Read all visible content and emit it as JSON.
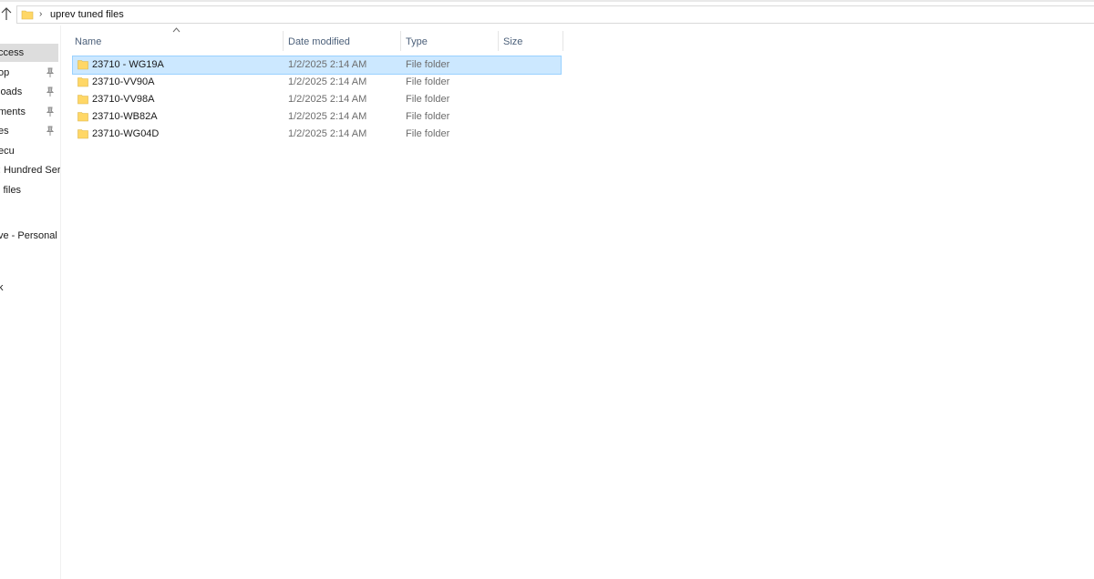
{
  "address": {
    "path_label": "uprev tuned files"
  },
  "nav": {
    "items": [
      {
        "label": "ccess",
        "pinned": false,
        "active": true
      },
      {
        "label": "op",
        "pinned": true,
        "active": false
      },
      {
        "label": "loads",
        "pinned": true,
        "active": false
      },
      {
        "label": "ments",
        "pinned": true,
        "active": false
      },
      {
        "label": "es",
        "pinned": true,
        "active": false
      },
      {
        "label": "ecu",
        "pinned": false,
        "active": false
      },
      {
        "label": ": Hundred Ser",
        "pinned": false,
        "active": false
      },
      {
        "label": "i files",
        "pinned": false,
        "active": false
      },
      {
        "label": "ve - Personal",
        "pinned": false,
        "active": false
      },
      {
        "label": "k",
        "pinned": false,
        "active": false
      }
    ]
  },
  "columns": {
    "name": "Name",
    "date_modified": "Date modified",
    "type": "Type",
    "size": "Size"
  },
  "files": [
    {
      "name": "23710 - WG19A",
      "date": "1/2/2025 2:14 AM",
      "type": "File folder",
      "selected": true
    },
    {
      "name": "23710-VV90A",
      "date": "1/2/2025 2:14 AM",
      "type": "File folder",
      "selected": false
    },
    {
      "name": "23710-VV98A",
      "date": "1/2/2025 2:14 AM",
      "type": "File folder",
      "selected": false
    },
    {
      "name": "23710-WB82A",
      "date": "1/2/2025 2:14 AM",
      "type": "File folder",
      "selected": false
    },
    {
      "name": "23710-WG04D",
      "date": "1/2/2025 2:14 AM",
      "type": "File folder",
      "selected": false
    }
  ],
  "colors": {
    "selection": "#cce8ff",
    "folder": "#ffd766",
    "header_text": "#4c607a"
  }
}
